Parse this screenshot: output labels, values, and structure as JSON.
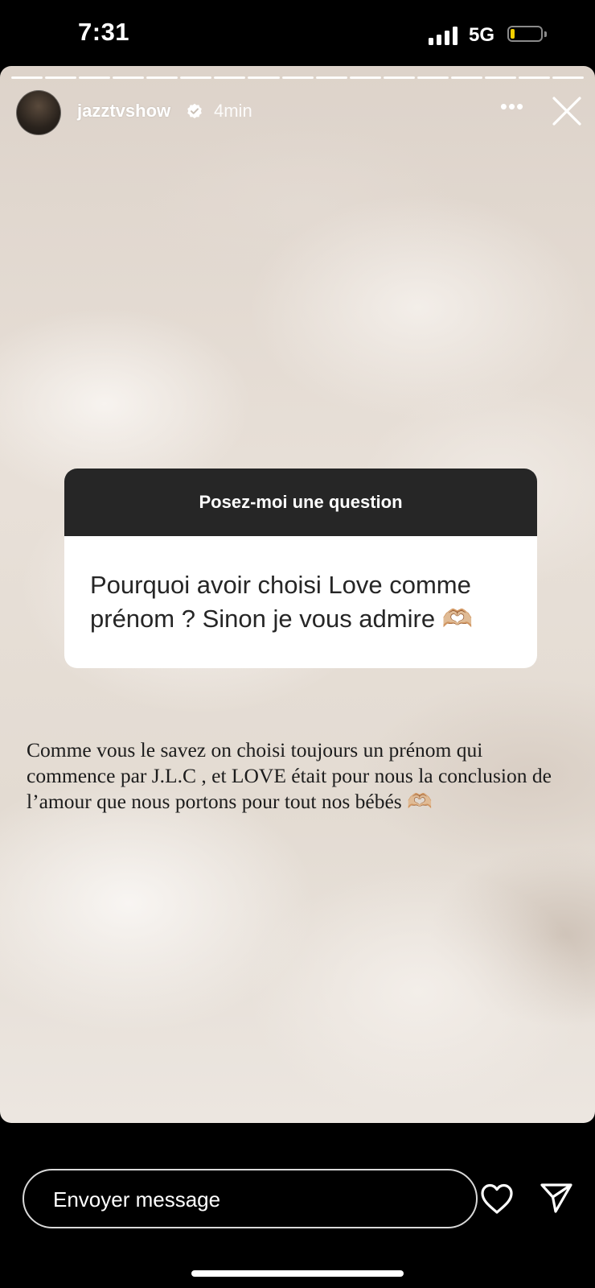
{
  "status": {
    "time": "7:31",
    "network": "5G"
  },
  "story": {
    "segments": 17,
    "username": "jazztvshow",
    "time_ago": "4min",
    "more_label": "•••"
  },
  "question": {
    "header": "Posez-moi une question",
    "text": "Pourquoi avoir choisi Love comme prénom ? Sinon je vous admire 🫶🏼"
  },
  "answer": {
    "text": "Comme vous le savez on choisi toujours un prénom qui commence par J.L.C , et LOVE  était pour nous la conclusion de l’amour que nous portons pour tout nos bébés 🫶🏼"
  },
  "reply": {
    "placeholder": "Envoyer message"
  },
  "colors": {
    "question_header": "#262626",
    "battery_level": "#f5d000"
  }
}
